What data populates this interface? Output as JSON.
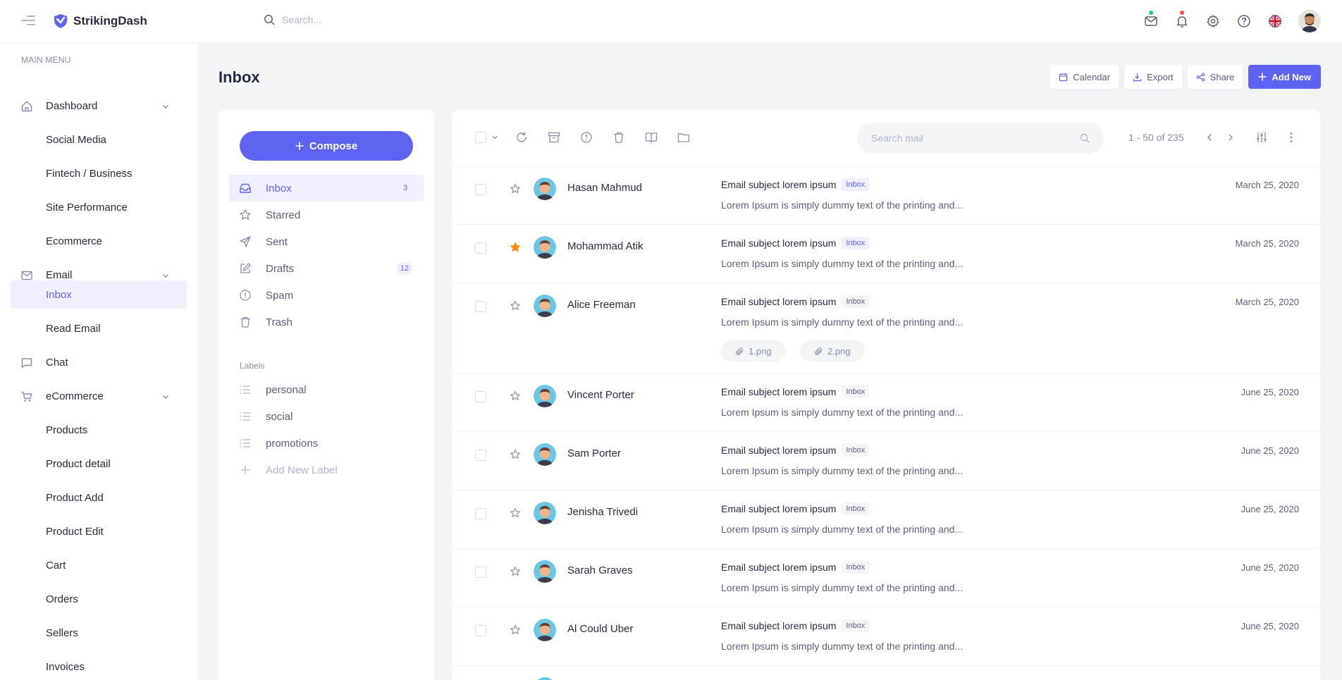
{
  "app": {
    "name": "StrikingDash"
  },
  "header": {
    "search_placeholder": "Search...",
    "icons": [
      "mail-icon",
      "bell-icon",
      "gear-icon",
      "help-icon",
      "flag-uk-icon",
      "avatar"
    ],
    "mail_dot_color": "#20c997",
    "bell_dot_color": "#ff4d4f"
  },
  "sidebar": {
    "menu_title": "MAIN MENU",
    "items": [
      {
        "label": "Dashboard",
        "icon": "home-icon",
        "expandable": true
      },
      {
        "label": "Social Media"
      },
      {
        "label": "Fintech / Business"
      },
      {
        "label": "Site Performance"
      },
      {
        "label": "Ecommerce"
      },
      {
        "label": "Email",
        "icon": "mail-icon",
        "expandable": true
      },
      {
        "label": "Inbox",
        "active": true
      },
      {
        "label": "Read Email"
      },
      {
        "label": "Chat",
        "icon": "chat-icon"
      },
      {
        "label": "eCommerce",
        "icon": "cart-icon",
        "expandable": true
      },
      {
        "label": "Products"
      },
      {
        "label": "Product detail"
      },
      {
        "label": "Product Add"
      },
      {
        "label": "Product Edit"
      },
      {
        "label": "Cart"
      },
      {
        "label": "Orders"
      },
      {
        "label": "Sellers"
      },
      {
        "label": "Invoices"
      }
    ]
  },
  "page": {
    "title": "Inbox",
    "actions": {
      "calendar": "Calendar",
      "export": "Export",
      "share": "Share",
      "add_new": "Add New"
    }
  },
  "mail_nav": {
    "compose": "Compose",
    "folders": [
      {
        "label": "Inbox",
        "icon": "inbox-icon",
        "count": "3",
        "active": true
      },
      {
        "label": "Starred",
        "icon": "star-icon"
      },
      {
        "label": "Sent",
        "icon": "send-icon"
      },
      {
        "label": "Drafts",
        "icon": "edit-icon",
        "count": "12"
      },
      {
        "label": "Spam",
        "icon": "alert-circle-icon"
      },
      {
        "label": "Trash",
        "icon": "trash-icon"
      }
    ],
    "labels_title": "Labels",
    "labels": [
      "personal",
      "social",
      "promotions"
    ],
    "add_label": "Add New Label"
  },
  "mail_list": {
    "search_placeholder": "Search mail",
    "pagination": "1 - 50 of 235",
    "accent_color": "#5f63f2",
    "star_active_color": "#fa8b0c",
    "emails": [
      {
        "name": "Hasan Mahmud",
        "subject": "Email subject lorem ipsum",
        "tag": "Inbox",
        "tag_style": "blue",
        "preview": "Lorem Ipsum is simply dummy text of the printing and...",
        "date": "March 25, 2020",
        "starred": false
      },
      {
        "name": "Mohammad Atik",
        "subject": "Email subject lorem ipsum",
        "tag": "Inbox",
        "tag_style": "blue",
        "preview": "Lorem Ipsum is simply dummy text of the printing and...",
        "date": "March 25, 2020",
        "starred": true
      },
      {
        "name": "Alice Freeman",
        "subject": "Email subject lorem ipsum",
        "tag": "Inbox",
        "tag_style": "gray",
        "preview": "Lorem Ipsum is simply dummy text of the printing and...",
        "date": "March 25, 2020",
        "starred": false,
        "attachments": [
          "1.png",
          "2.png"
        ]
      },
      {
        "name": "Vincent Porter",
        "subject": "Email subject lorem ipsum",
        "tag": "Inbox",
        "tag_style": "gray",
        "preview": "Lorem Ipsum is simply dummy text of the printing and...",
        "date": "June 25, 2020",
        "starred": false
      },
      {
        "name": "Sam Porter",
        "subject": "Email subject lorem ipsum",
        "tag": "Inbox",
        "tag_style": "gray",
        "preview": "Lorem Ipsum is simply dummy text of the printing and...",
        "date": "June 25, 2020",
        "starred": false
      },
      {
        "name": "Jenisha Trivedi",
        "subject": "Email subject lorem ipsum",
        "tag": "Inbox",
        "tag_style": "gray",
        "preview": "Lorem Ipsum is simply dummy text of the printing and...",
        "date": "June 25, 2020",
        "starred": false
      },
      {
        "name": "Sarah Graves",
        "subject": "Email subject lorem ipsum",
        "tag": "Inbox",
        "tag_style": "gray",
        "preview": "Lorem Ipsum is simply dummy text of the printing and...",
        "date": "June 25, 2020",
        "starred": false
      },
      {
        "name": "Al Could Uber",
        "subject": "Email subject lorem ipsum",
        "tag": "Inbox",
        "tag_style": "gray",
        "preview": "Lorem Ipsum is simply dummy text of the printing and...",
        "date": "June 25, 2020",
        "starred": false
      }
    ]
  }
}
